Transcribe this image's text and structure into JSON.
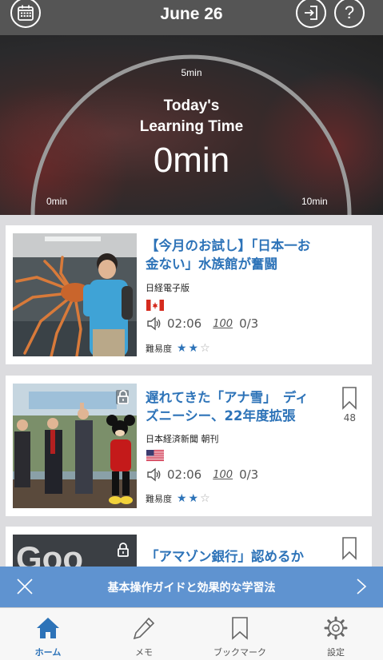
{
  "header": {
    "title": "June 26",
    "help_label": "?"
  },
  "hero": {
    "scale_top": "5min",
    "title_line1": "Today's",
    "title_line2": "Learning Time",
    "value": "0min",
    "scale_left": "0min",
    "scale_right": "10min",
    "progress_fraction": 0
  },
  "articles": [
    {
      "headline_line1": "【今月のお試し】「日本一お",
      "headline_line2": "金ない」水族館が奮闘",
      "source": "日経電子版",
      "flag": "canada-flag",
      "duration": "02:06",
      "score": "0/3",
      "difficulty_label": "難易度",
      "stars": 2,
      "locked": false
    },
    {
      "headline_line1": "遅れてきた「アナ雪」　ディ",
      "headline_line2": "ズニーシー、22年度拡張",
      "source": "日本経済新聞 朝刊",
      "flag": "usa-flag",
      "duration": "02:06",
      "score": "0/3",
      "difficulty_label": "難易度",
      "stars": 2,
      "locked": true,
      "bookmark_count": "48"
    },
    {
      "headline_line1": "「アマゾン銀行」認めるか",
      "locked": true
    }
  ],
  "banner": {
    "text": "基本操作ガイドと効果的な学習法"
  },
  "tabs": [
    {
      "label": "ホーム",
      "icon": "home-icon",
      "active": true
    },
    {
      "label": "メモ",
      "icon": "pencil-icon",
      "active": false
    },
    {
      "label": "ブックマーク",
      "icon": "bookmark-icon",
      "active": false
    },
    {
      "label": "設定",
      "icon": "gear-icon",
      "active": false
    }
  ],
  "colors": {
    "accent": "#2d73b8",
    "header_bg": "#555555",
    "banner_bg": "#5f93d0"
  }
}
